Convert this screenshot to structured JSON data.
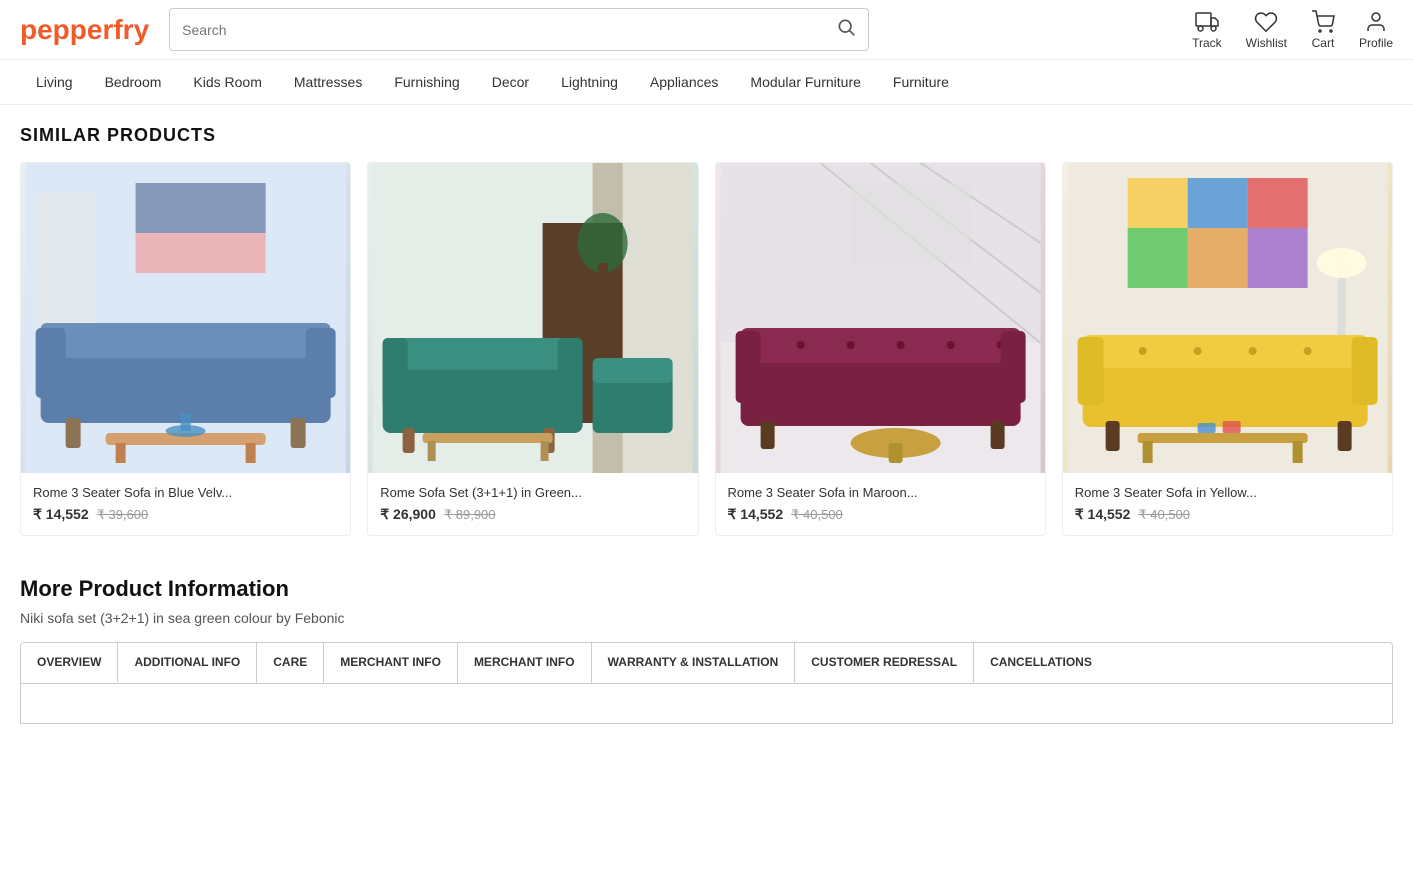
{
  "brand": {
    "name": "pepperfry",
    "logo_text": "pepperfry"
  },
  "header": {
    "search_placeholder": "Search",
    "actions": [
      {
        "id": "track",
        "label": "Track",
        "icon": "truck"
      },
      {
        "id": "wishlist",
        "label": "Wishlist",
        "icon": "heart"
      },
      {
        "id": "cart",
        "label": "Cart",
        "icon": "cart"
      },
      {
        "id": "profile",
        "label": "Profile",
        "icon": "user"
      }
    ]
  },
  "nav": {
    "items": [
      {
        "id": "living",
        "label": "Living"
      },
      {
        "id": "bedroom",
        "label": "Bedroom"
      },
      {
        "id": "kids-room",
        "label": "Kids Room"
      },
      {
        "id": "mattresses",
        "label": "Mattresses"
      },
      {
        "id": "furnishing",
        "label": "Furnishing"
      },
      {
        "id": "decor",
        "label": "Decor"
      },
      {
        "id": "lightning",
        "label": "Lightning"
      },
      {
        "id": "appliances",
        "label": "Appliances"
      },
      {
        "id": "modular-furniture",
        "label": "Modular Furniture"
      },
      {
        "id": "furniture",
        "label": "Furniture"
      }
    ]
  },
  "similar_products": {
    "section_title": "SIMILAR PRODUCTS",
    "products": [
      {
        "id": 1,
        "name": "Rome 3 Seater Sofa in Blue Velv...",
        "price_current": "₹ 14,552",
        "price_original": "₹ 39,600",
        "color_theme": "blue"
      },
      {
        "id": 2,
        "name": "Rome Sofa Set (3+1+1) in Green...",
        "price_current": "₹ 26,900",
        "price_original": "₹ 89,900",
        "color_theme": "teal"
      },
      {
        "id": 3,
        "name": "Rome 3 Seater Sofa in Maroon...",
        "price_current": "₹ 14,552",
        "price_original": "₹ 40,500",
        "color_theme": "maroon"
      },
      {
        "id": 4,
        "name": "Rome 3 Seater Sofa in Yellow...",
        "price_current": "₹ 14,552",
        "price_original": "₹ 40,500",
        "color_theme": "yellow"
      }
    ]
  },
  "product_info": {
    "section_title": "More Product Information",
    "subtitle": "Niki sofa set (3+2+1) in sea green colour by Febonic",
    "tabs": [
      {
        "id": "overview",
        "label": "OVERVIEW",
        "active": true
      },
      {
        "id": "additional-info",
        "label": "ADDITIONAL INFO",
        "active": false
      },
      {
        "id": "care",
        "label": "CARE",
        "active": false
      },
      {
        "id": "merchant-info-1",
        "label": "MERCHANT INFO",
        "active": false
      },
      {
        "id": "merchant-info-2",
        "label": "MERCHANT INFO",
        "active": false
      },
      {
        "id": "warranty",
        "label": "WARRANTY & INSTALLATION",
        "active": false
      },
      {
        "id": "customer-redressal",
        "label": "CUSTOMER REDRESSAL",
        "active": false
      },
      {
        "id": "cancellations",
        "label": "CANCELLATIONS",
        "active": false
      }
    ]
  }
}
